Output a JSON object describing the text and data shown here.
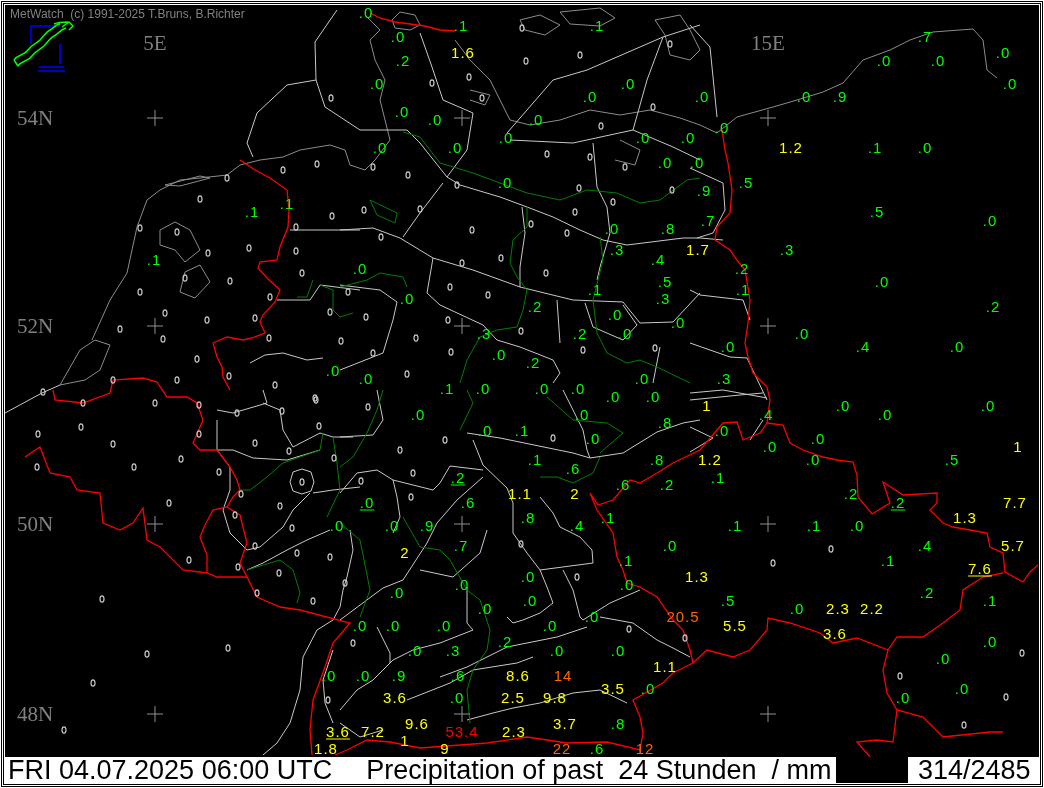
{
  "header": {
    "copyright": "MetWatch  (c) 1991-2025 T.Bruns, B.Richter"
  },
  "map": {
    "longitude_labels": [
      "5E",
      "15E"
    ],
    "latitude_labels": [
      "54N",
      "52N",
      "50N",
      "48N"
    ],
    "precipitation_values": [
      {
        "value": ".0",
        "color": "#00ff00",
        "underlined": false
      },
      {
        "value": ".1",
        "color": "#00ff00",
        "underlined": false
      },
      {
        "value": ".1",
        "color": "#00ff00",
        "underlined": false
      },
      {
        "value": ".0",
        "color": "#00ff00",
        "underlined": false
      },
      {
        "value": ".7",
        "color": "#00ff00",
        "underlined": false
      },
      {
        "value": "1.6",
        "color": "#ffff00",
        "underlined": false
      },
      {
        "value": ".0",
        "color": "#00ff00",
        "underlined": false
      },
      {
        "value": ".2",
        "color": "#00ff00",
        "underlined": false
      },
      {
        "value": ".0",
        "color": "#00ff00",
        "underlined": false
      },
      {
        "value": ".0",
        "color": "#00ff00",
        "underlined": false
      },
      {
        "value": ".0",
        "color": "#00ff00",
        "underlined": false
      },
      {
        "value": ".0",
        "color": "#00ff00",
        "underlined": false
      },
      {
        "value": ".0",
        "color": "#00ff00",
        "underlined": false
      },
      {
        "value": ".0",
        "color": "#00ff00",
        "underlined": false
      },
      {
        "value": ".0",
        "color": "#00ff00",
        "underlined": false
      },
      {
        "value": ".0",
        "color": "#00ff00",
        "underlined": false
      },
      {
        "value": ".9",
        "color": "#00ff00",
        "underlined": false
      },
      {
        "value": ".0",
        "color": "#00ff00",
        "underlined": false
      },
      {
        "value": ".0",
        "color": "#00ff00",
        "underlined": false
      },
      {
        "value": ".0",
        "color": "#00ff00",
        "underlined": false
      },
      {
        "value": ".0",
        "color": "#00ff00",
        "underlined": false
      },
      {
        "value": ".0",
        "color": "#00ff00",
        "underlined": false
      },
      {
        "value": ".0",
        "color": "#00ff00",
        "underlined": false
      },
      {
        "value": ".0",
        "color": "#00ff00",
        "underlined": false
      },
      {
        "value": ".0",
        "color": "#00ff00",
        "underlined": false
      },
      {
        "value": ".0",
        "color": "#00ff00",
        "underlined": false
      },
      {
        "value": "1.2",
        "color": "#ffff00",
        "underlined": false
      },
      {
        "value": ".1",
        "color": "#00ff00",
        "underlined": false
      },
      {
        "value": ".0",
        "color": "#00ff00",
        "underlined": false
      },
      {
        "value": ".0",
        "color": "#00ff00",
        "underlined": false
      },
      {
        "value": ".0",
        "color": "#00ff00",
        "underlined": false
      },
      {
        "value": ".0",
        "color": "#00ff00",
        "underlined": false
      },
      {
        "value": ".5",
        "color": "#00ff00",
        "underlined": false
      },
      {
        "value": ".9",
        "color": "#00ff00",
        "underlined": false
      },
      {
        "value": ".1",
        "color": "#00ff00",
        "underlined": false
      },
      {
        "value": ".1",
        "color": "#00ff00",
        "underlined": false
      },
      {
        "value": ".5",
        "color": "#00ff00",
        "underlined": false
      },
      {
        "value": ".7",
        "color": "#00ff00",
        "underlined": false
      },
      {
        "value": ".0",
        "color": "#00ff00",
        "underlined": false
      },
      {
        "value": ".0",
        "color": "#00ff00",
        "underlined": false
      },
      {
        "value": ".8",
        "color": "#00ff00",
        "underlined": false
      },
      {
        "value": ".3",
        "color": "#00ff00",
        "underlined": false
      },
      {
        "value": "1.7",
        "color": "#ffff00",
        "underlined": false
      },
      {
        "value": ".3",
        "color": "#00ff00",
        "underlined": false
      },
      {
        "value": ".1",
        "color": "#00ff00",
        "underlined": false
      },
      {
        "value": ".4",
        "color": "#00ff00",
        "underlined": false
      },
      {
        "value": ".0",
        "color": "#00ff00",
        "underlined": false
      },
      {
        "value": ".2",
        "color": "#00ff00",
        "underlined": false
      },
      {
        "value": ".5",
        "color": "#00ff00",
        "underlined": false
      },
      {
        "value": ".0",
        "color": "#00ff00",
        "underlined": false
      },
      {
        "value": ".1",
        "color": "#00ff00",
        "underlined": false
      },
      {
        "value": ".1",
        "color": "#00ff00",
        "underlined": false
      },
      {
        "value": ".0",
        "color": "#00ff00",
        "underlined": false
      },
      {
        "value": ".3",
        "color": "#00ff00",
        "underlined": false
      },
      {
        "value": ".2",
        "color": "#00ff00",
        "underlined": false
      },
      {
        "value": ".2",
        "color": "#00ff00",
        "underlined": false
      },
      {
        "value": ".0",
        "color": "#00ff00",
        "underlined": false
      },
      {
        "value": ".0",
        "color": "#00ff00",
        "underlined": false
      },
      {
        "value": ".3",
        "color": "#00ff00",
        "underlined": false
      },
      {
        "value": ".2",
        "color": "#00ff00",
        "underlined": false
      },
      {
        "value": ".0",
        "color": "#00ff00",
        "underlined": false
      },
      {
        "value": ".0",
        "color": "#00ff00",
        "underlined": false
      },
      {
        "value": ".0",
        "color": "#00ff00",
        "underlined": false
      },
      {
        "value": ".4",
        "color": "#00ff00",
        "underlined": false
      },
      {
        "value": ".0",
        "color": "#00ff00",
        "underlined": false
      },
      {
        "value": ".0",
        "color": "#00ff00",
        "underlined": false
      },
      {
        "value": ".2",
        "color": "#00ff00",
        "underlined": false
      },
      {
        "value": ".0",
        "color": "#00ff00",
        "underlined": false
      },
      {
        "value": ".0",
        "color": "#00ff00",
        "underlined": false
      },
      {
        "value": ".0",
        "color": "#00ff00",
        "underlined": false
      },
      {
        "value": ".3",
        "color": "#00ff00",
        "underlined": false
      },
      {
        "value": ".1",
        "color": "#00ff00",
        "underlined": false
      },
      {
        "value": ".0",
        "color": "#00ff00",
        "underlined": false
      },
      {
        "value": ".0",
        "color": "#00ff00",
        "underlined": false
      },
      {
        "value": ".0",
        "color": "#00ff00",
        "underlined": false
      },
      {
        "value": ".0",
        "color": "#00ff00",
        "underlined": false
      },
      {
        "value": ".0",
        "color": "#00ff00",
        "underlined": false
      },
      {
        "value": "1",
        "color": "#ffff00",
        "underlined": false
      },
      {
        "value": ".0",
        "color": "#00ff00",
        "underlined": false
      },
      {
        "value": ".0",
        "color": "#00ff00",
        "underlined": false
      },
      {
        "value": ".0",
        "color": "#00ff00",
        "underlined": false
      },
      {
        "value": ".0",
        "color": "#00ff00",
        "underlined": false
      },
      {
        "value": ".4",
        "color": "#00ff00",
        "underlined": false
      },
      {
        "value": ".0",
        "color": "#00ff00",
        "underlined": false
      },
      {
        "value": ".8",
        "color": "#00ff00",
        "underlined": false
      },
      {
        "value": ".0",
        "color": "#00ff00",
        "underlined": false
      },
      {
        "value": ".1",
        "color": "#00ff00",
        "underlined": false
      },
      {
        "value": ".0",
        "color": "#00ff00",
        "underlined": false
      },
      {
        "value": ".0",
        "color": "#00ff00",
        "underlined": false
      },
      {
        "value": ".0",
        "color": "#00ff00",
        "underlined": false
      },
      {
        "value": ".0",
        "color": "#00ff00",
        "underlined": false
      },
      {
        "value": "1",
        "color": "#ffff00",
        "underlined": false
      },
      {
        "value": ".1",
        "color": "#00ff00",
        "underlined": false
      },
      {
        "value": ".8",
        "color": "#00ff00",
        "underlined": false
      },
      {
        "value": "1.2",
        "color": "#ffff00",
        "underlined": false
      },
      {
        "value": ".0",
        "color": "#00ff00",
        "underlined": false
      },
      {
        "value": ".5",
        "color": "#00ff00",
        "underlined": false
      },
      {
        "value": ".6",
        "color": "#00ff00",
        "underlined": false
      },
      {
        "value": ".2",
        "color": "#00ff00",
        "underlined": true
      },
      {
        "value": ".1",
        "color": "#00ff00",
        "underlined": false
      },
      {
        "value": ".6",
        "color": "#00ff00",
        "underlined": false
      },
      {
        "value": ".2",
        "color": "#00ff00",
        "underlined": false
      },
      {
        "value": "1.1",
        "color": "#ffff00",
        "underlined": false
      },
      {
        "value": "2",
        "color": "#ffff00",
        "underlined": false
      },
      {
        "value": ".2",
        "color": "#00ff00",
        "underlined": false
      },
      {
        "value": ".0",
        "color": "#00ff00",
        "underlined": true
      },
      {
        "value": ".6",
        "color": "#00ff00",
        "underlined": false
      },
      {
        "value": ".2",
        "color": "#00ff00",
        "underlined": true
      },
      {
        "value": "7.7",
        "color": "#ffff00",
        "underlined": false
      },
      {
        "value": ".8",
        "color": "#00ff00",
        "underlined": false
      },
      {
        "value": ".1",
        "color": "#00ff00",
        "underlined": false
      },
      {
        "value": "1.3",
        "color": "#ffff00",
        "underlined": false
      },
      {
        "value": ".0",
        "color": "#00ff00",
        "underlined": false
      },
      {
        "value": ".0",
        "color": "#00ff00",
        "underlined": false
      },
      {
        "value": ".9",
        "color": "#00ff00",
        "underlined": false
      },
      {
        "value": ".4",
        "color": "#00ff00",
        "underlined": false
      },
      {
        "value": ".1",
        "color": "#00ff00",
        "underlined": false
      },
      {
        "value": ".1",
        "color": "#00ff00",
        "underlined": false
      },
      {
        "value": ".0",
        "color": "#00ff00",
        "underlined": false
      },
      {
        "value": ".7",
        "color": "#00ff00",
        "underlined": false
      },
      {
        "value": ".0",
        "color": "#00ff00",
        "underlined": false
      },
      {
        "value": ".4",
        "color": "#00ff00",
        "underlined": false
      },
      {
        "value": "5.7",
        "color": "#ffff00",
        "underlined": false
      },
      {
        "value": "2",
        "color": "#ffff00",
        "underlined": false
      },
      {
        "value": ".1",
        "color": "#00ff00",
        "underlined": false
      },
      {
        "value": ".1",
        "color": "#00ff00",
        "underlined": false
      },
      {
        "value": "7.6",
        "color": "#ffff00",
        "underlined": true
      },
      {
        "value": ".0",
        "color": "#00ff00",
        "underlined": false
      },
      {
        "value": "1.3",
        "color": "#ffff00",
        "underlined": false
      },
      {
        "value": ".0",
        "color": "#00ff00",
        "underlined": false
      },
      {
        "value": ".0",
        "color": "#00ff00",
        "underlined": false
      },
      {
        "value": ".0",
        "color": "#00ff00",
        "underlined": false
      },
      {
        "value": ".2",
        "color": "#00ff00",
        "underlined": false
      },
      {
        "value": ".0",
        "color": "#00ff00",
        "underlined": false
      },
      {
        "value": ".5",
        "color": "#00ff00",
        "underlined": false
      },
      {
        "value": ".1",
        "color": "#00ff00",
        "underlined": false
      },
      {
        "value": ".0",
        "color": "#00ff00",
        "underlined": false
      },
      {
        "value": ".0",
        "color": "#00ff00",
        "underlined": false
      },
      {
        "value": "2.3",
        "color": "#ffff00",
        "underlined": false
      },
      {
        "value": "2.2",
        "color": "#ffff00",
        "underlined": false
      },
      {
        "value": ".0",
        "color": "#00ff00",
        "underlined": false
      },
      {
        "value": "20.5",
        "color": "#ff6600",
        "underlined": false
      },
      {
        "value": ".0",
        "color": "#00ff00",
        "underlined": false
      },
      {
        "value": ".0",
        "color": "#00ff00",
        "underlined": false
      },
      {
        "value": ".0",
        "color": "#00ff00",
        "underlined": false
      },
      {
        "value": ".0",
        "color": "#00ff00",
        "underlined": false
      },
      {
        "value": "5.5",
        "color": "#ffff00",
        "underlined": false
      },
      {
        "value": "3.6",
        "color": "#ffff00",
        "underlined": false
      },
      {
        "value": ".2",
        "color": "#00ff00",
        "underlined": false
      },
      {
        "value": ".0",
        "color": "#00ff00",
        "underlined": false
      },
      {
        "value": ".0",
        "color": "#00ff00",
        "underlined": false
      },
      {
        "value": ".3",
        "color": "#00ff00",
        "underlined": false
      },
      {
        "value": ".0",
        "color": "#00ff00",
        "underlined": false
      },
      {
        "value": ".0",
        "color": "#00ff00",
        "underlined": false
      },
      {
        "value": ".0",
        "color": "#00ff00",
        "underlined": false
      },
      {
        "value": "1.1",
        "color": "#ffff00",
        "underlined": false
      },
      {
        "value": ".0",
        "color": "#00ff00",
        "underlined": false
      },
      {
        "value": ".0",
        "color": "#00ff00",
        "underlined": false
      },
      {
        "value": ".9",
        "color": "#00ff00",
        "underlined": false
      },
      {
        "value": ".6",
        "color": "#00ff00",
        "underlined": false
      },
      {
        "value": "8.6",
        "color": "#ffff00",
        "underlined": false
      },
      {
        "value": "14",
        "color": "#ff6600",
        "underlined": false
      },
      {
        "value": "3.5",
        "color": "#ffff00",
        "underlined": false
      },
      {
        "value": ".0",
        "color": "#00ff00",
        "underlined": false
      },
      {
        "value": ".0",
        "color": "#00ff00",
        "underlined": false
      },
      {
        "value": "3.6",
        "color": "#ffff00",
        "underlined": false
      },
      {
        "value": ".0",
        "color": "#00ff00",
        "underlined": false
      },
      {
        "value": "2.5",
        "color": "#ffff00",
        "underlined": false
      },
      {
        "value": "9.8",
        "color": "#ffff00",
        "underlined": false
      },
      {
        "value": ".0",
        "color": "#00ff00",
        "underlined": false
      },
      {
        "value": "9.6",
        "color": "#ffff00",
        "underlined": false
      },
      {
        "value": "3.7",
        "color": "#ffff00",
        "underlined": false
      },
      {
        "value": ".8",
        "color": "#00ff00",
        "underlined": false
      },
      {
        "value": "3.6",
        "color": "#ffff00",
        "underlined": true
      },
      {
        "value": "7.2",
        "color": "#ffff00",
        "underlined": false
      },
      {
        "value": "53.4",
        "color": "#ff0000",
        "underlined": false
      },
      {
        "value": "2.3",
        "color": "#ffff00",
        "underlined": false
      },
      {
        "value": "1",
        "color": "#ffff00",
        "underlined": false
      },
      {
        "value": "1.8",
        "color": "#ffff00",
        "underlined": false
      },
      {
        "value": "9",
        "color": "#ffff00",
        "underlined": false
      },
      {
        "value": "22",
        "color": "#ff6600",
        "underlined": false
      },
      {
        "value": ".6",
        "color": "#00ff00",
        "underlined": false
      },
      {
        "value": "12",
        "color": "#ff6600",
        "underlined": false
      }
    ]
  },
  "status_bar": {
    "datetime": "FRI 04.07.2025 06:00 UTC",
    "parameter": "Precipitation of past  24 Stunden  / mm",
    "count": "314/2485"
  }
}
